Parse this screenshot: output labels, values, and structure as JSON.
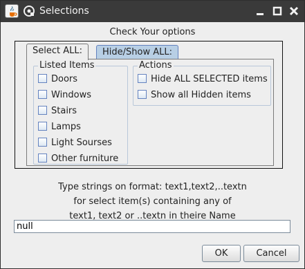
{
  "window": {
    "title": "Selections",
    "app_icon": "java-cup-icon",
    "menu_icon": "window-menu-icon",
    "controls": [
      "minimize-icon",
      "maximize-icon",
      "close-icon"
    ]
  },
  "heading": "Check Your options",
  "tabs": [
    {
      "label": "Select ALL:",
      "selected": true
    },
    {
      "label": "Hide/Show ALL:",
      "selected": false
    }
  ],
  "listed_items": {
    "legend": "Listed Items",
    "items": [
      {
        "label": "Doors",
        "checked": false
      },
      {
        "label": "Windows",
        "checked": false
      },
      {
        "label": "Stairs",
        "checked": false
      },
      {
        "label": "Lamps",
        "checked": false
      },
      {
        "label": "Light Sourses",
        "checked": false
      },
      {
        "label": "Other furniture",
        "checked": false
      }
    ]
  },
  "actions": {
    "legend": "Actions",
    "items": [
      {
        "label": "Hide ALL SELECTED items",
        "checked": false
      },
      {
        "label": "Show all Hidden items",
        "checked": false
      }
    ]
  },
  "instructions": [
    "Type strings on format: text1,text2,..textn",
    "for select item(s) containing any of",
    "text1, text2 or ..textn in theire Name"
  ],
  "input": {
    "value": "null"
  },
  "buttons": {
    "ok": "OK",
    "cancel": "Cancel"
  },
  "colors": {
    "titlebar": "#3a3a3a",
    "tab_inactive": "#b8cfe5",
    "checkbox_border": "#6382bf"
  }
}
